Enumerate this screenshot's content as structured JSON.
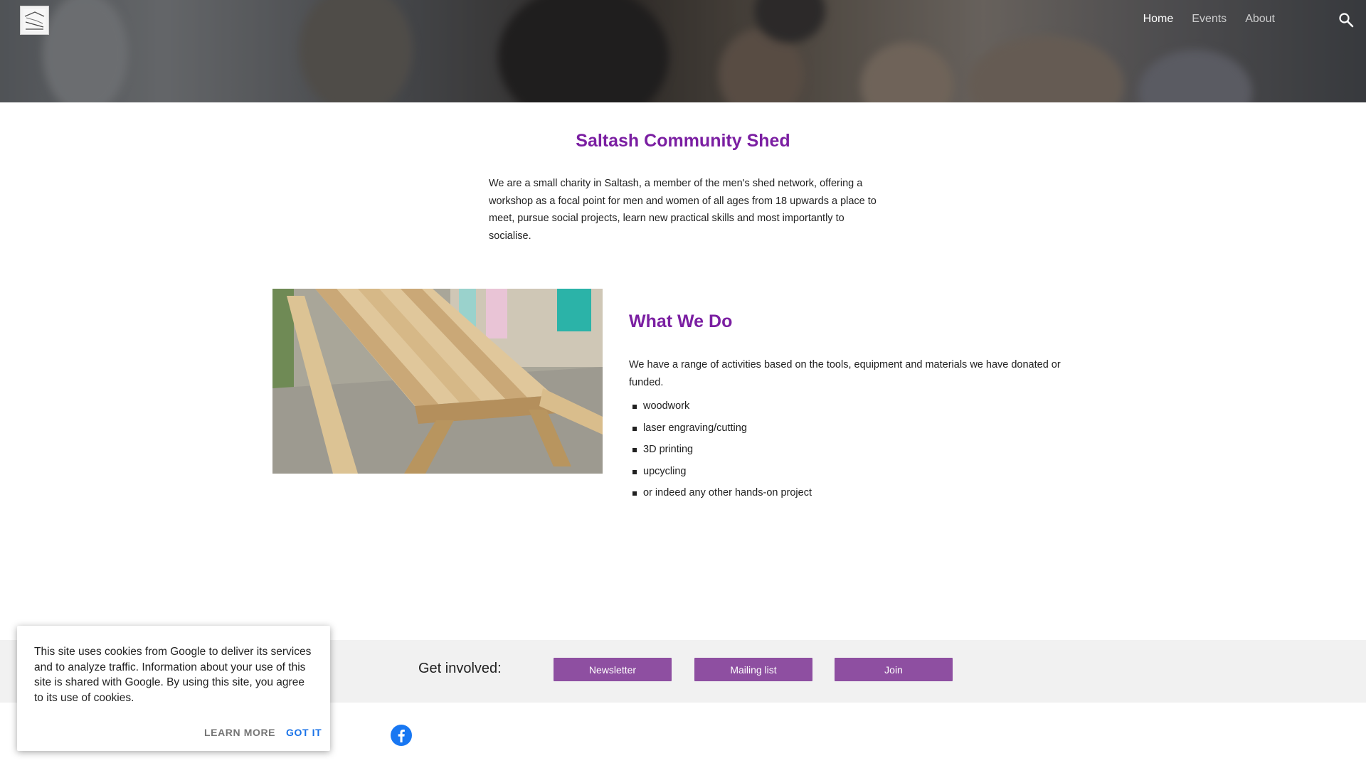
{
  "nav": {
    "items": [
      {
        "label": "Home",
        "active": true
      },
      {
        "label": "Events",
        "active": false
      },
      {
        "label": "About",
        "active": false
      }
    ]
  },
  "intro": {
    "title": "Saltash Community Shed",
    "text": "We are a small charity in Saltash, a member of the men's shed network, offering a workshop as a focal point for men and women of all ages from 18 upwards a place to meet, pursue social projects, learn new practical skills and most importantly to socialise."
  },
  "what_we_do": {
    "title": "What We Do",
    "text": "We have a range of activities based on the tools, equipment and materials we have donated or funded.",
    "items": [
      "woodwork",
      "laser engraving/cutting",
      "3D printing",
      "upcycling",
      "or indeed any other hands-on project"
    ]
  },
  "get_involved": {
    "label": "Get involved:",
    "buttons": [
      "Newsletter",
      "Mailing list",
      "Join"
    ]
  },
  "cookie": {
    "text": "This site uses cookies from Google to deliver its services and to analyze traffic. Information about your use of this site is shared with Google. By using this site, you agree to its use of cookies.",
    "learn_more": "LEARN MORE",
    "got_it": "GOT IT"
  },
  "colors": {
    "title_purple": "#7b1fa2",
    "button_purple": "#8e4fa1",
    "link_blue": "#1a73e8",
    "facebook_blue": "#1877f2"
  },
  "icons": [
    "search-icon",
    "facebook-icon",
    "site-logo"
  ]
}
